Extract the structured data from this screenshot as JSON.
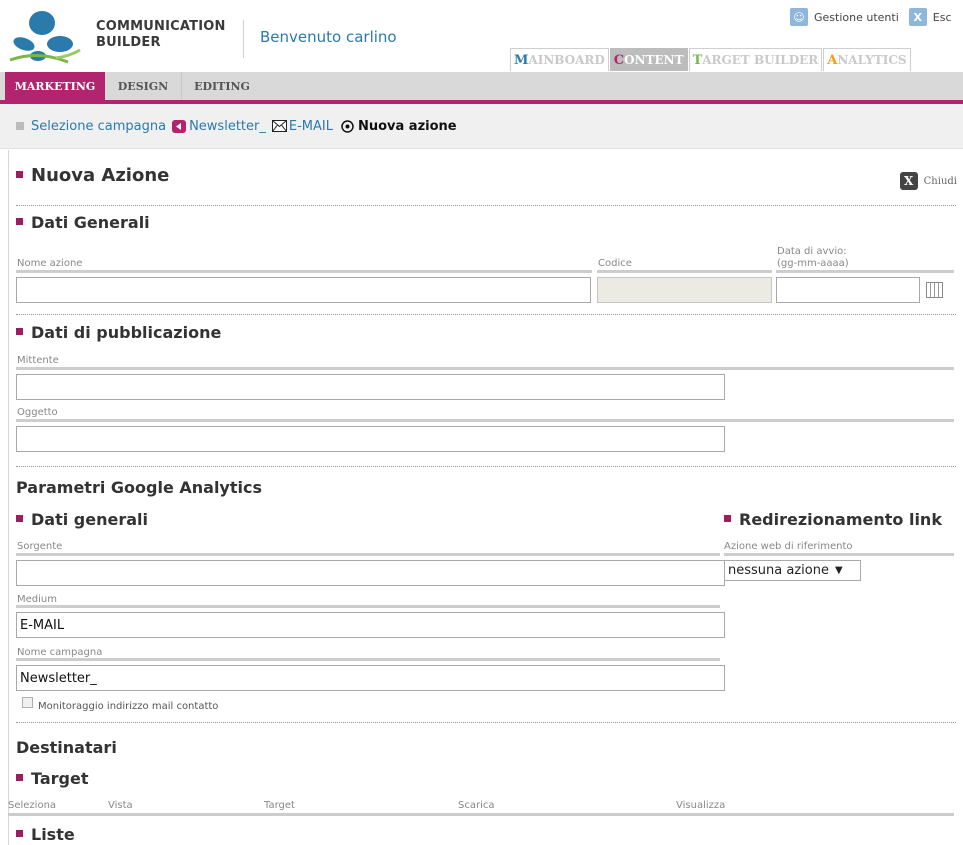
{
  "header": {
    "logo_line1": "COMMUNICATION",
    "logo_line2": "BUILDER",
    "welcome": "Benvenuto carlino",
    "user_links": [
      {
        "label": "Gestione utenti",
        "icon": "users-icon",
        "color": "#8fb7d9"
      },
      {
        "label": "Esc",
        "icon": "exit-icon",
        "color": "#8fb7d9"
      }
    ],
    "main_tabs": [
      {
        "initial": "M",
        "rest": "AINBOARD",
        "initial_color": "#2a7aab",
        "active": false
      },
      {
        "initial": "C",
        "rest": "ONTENT",
        "initial_color": "#b3246f",
        "active": true
      },
      {
        "initial": "T",
        "rest": "ARGET BUILDER",
        "initial_color": "#7ab648",
        "active": false
      },
      {
        "initial": "A",
        "rest": "NALYTICS",
        "initial_color": "#f39c12",
        "active": false
      }
    ]
  },
  "subtabs": [
    "MARKETING",
    "DESIGN",
    "EDITING"
  ],
  "breadcrumb": {
    "campaign": "Selezione campagna",
    "newsletter": "Newsletter_",
    "email": "E-MAIL",
    "current": "Nuova azione"
  },
  "page": {
    "title": "Nuova Azione",
    "close_label": "Chiudi"
  },
  "dati_generali": {
    "heading": "Dati Generali",
    "nome_label": "Nome azione",
    "codice_label": "Codice",
    "data_label_1": "Data di avvio:",
    "data_label_2": "(gg-mm-aaaa)",
    "nome_value": "",
    "codice_value": "",
    "data_value": ""
  },
  "pubblicazione": {
    "heading": "Dati di pubblicazione",
    "mittente_label": "Mittente",
    "mittente_value": "",
    "oggetto_label": "Oggetto",
    "oggetto_value": ""
  },
  "ga": {
    "heading": "Parametri Google Analytics",
    "generali_heading": "Dati generali",
    "sorgente_label": "Sorgente",
    "sorgente_value": "",
    "medium_label": "Medium",
    "medium_value": "E-MAIL",
    "campagna_label": "Nome campagna",
    "campagna_value": "Newsletter_",
    "monitor_label": "Monitoraggio indirizzo mail contatto",
    "redirect_heading": "Redirezionamento link",
    "azione_label": "Azione web di riferimento",
    "azione_value": "nessuna azione"
  },
  "destinatari": {
    "heading": "Destinatari",
    "target_heading": "Target",
    "columns": [
      "Seleziona",
      "Vista",
      "Target",
      "Scarica",
      "Visualizza"
    ],
    "liste_heading": "Liste"
  }
}
